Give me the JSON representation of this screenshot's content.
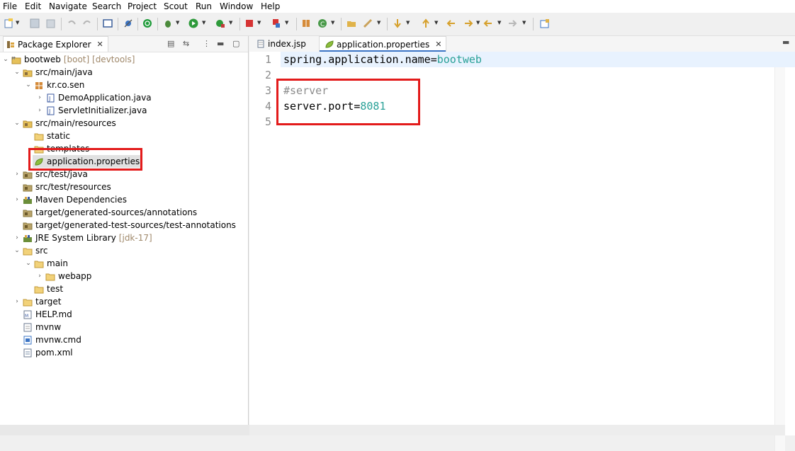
{
  "menu": [
    "File",
    "Edit",
    "Navigate",
    "Search",
    "Project",
    "Scout",
    "Run",
    "Window",
    "Help"
  ],
  "left_panel": {
    "tab_label": "Package Explorer",
    "tree": [
      {
        "label": "bootweb",
        "decor": "[boot] [devtools]",
        "icon": "project-icon"
      },
      {
        "label": "src/main/java",
        "icon": "source-folder-icon"
      },
      {
        "label": "kr.co.sen",
        "icon": "package-icon"
      },
      {
        "label": "DemoApplication.java",
        "icon": "java-file-icon"
      },
      {
        "label": "ServletInitializer.java",
        "icon": "java-file-icon"
      },
      {
        "label": "src/main/resources",
        "icon": "source-folder-icon"
      },
      {
        "label": "static",
        "icon": "folder-icon"
      },
      {
        "label": "templates",
        "icon": "folder-icon"
      },
      {
        "label": "application.properties",
        "icon": "spring-properties-icon"
      },
      {
        "label": "src/test/java",
        "icon": "source-folder-icon"
      },
      {
        "label": "src/test/resources",
        "icon": "source-folder-icon"
      },
      {
        "label": "Maven Dependencies",
        "icon": "library-icon"
      },
      {
        "label": "target/generated-sources/annotations",
        "icon": "source-folder-icon"
      },
      {
        "label": "target/generated-test-sources/test-annotations",
        "icon": "source-folder-icon"
      },
      {
        "label": "JRE System Library",
        "decor": "[jdk-17]",
        "icon": "library-icon"
      },
      {
        "label": "src",
        "icon": "folder-icon"
      },
      {
        "label": "main",
        "icon": "folder-icon"
      },
      {
        "label": "webapp",
        "icon": "folder-icon"
      },
      {
        "label": "test",
        "icon": "folder-icon"
      },
      {
        "label": "target",
        "icon": "folder-icon"
      },
      {
        "label": "HELP.md",
        "icon": "markdown-file-icon"
      },
      {
        "label": "mvnw",
        "icon": "file-icon"
      },
      {
        "label": "mvnw.cmd",
        "icon": "cmd-file-icon"
      },
      {
        "label": "pom.xml",
        "icon": "xml-file-icon"
      }
    ]
  },
  "editor": {
    "tabs": [
      {
        "label": "index.jsp"
      },
      {
        "label": "application.properties"
      }
    ],
    "line_numbers": [
      "1",
      "2",
      "3",
      "4",
      "5"
    ],
    "lines": [
      {
        "key": "spring.application.name",
        "eq": "=",
        "value": "bootweb"
      },
      {
        "text": ""
      },
      {
        "comment": "#server"
      },
      {
        "key": "server.port",
        "eq": "=",
        "value": "8081"
      },
      {
        "text": ""
      }
    ]
  },
  "colors": {
    "highlight_border": "#e31b1b",
    "value_color": "#2aa198",
    "comment_color": "#8c8c8c",
    "selection": "#e1e1e1"
  }
}
